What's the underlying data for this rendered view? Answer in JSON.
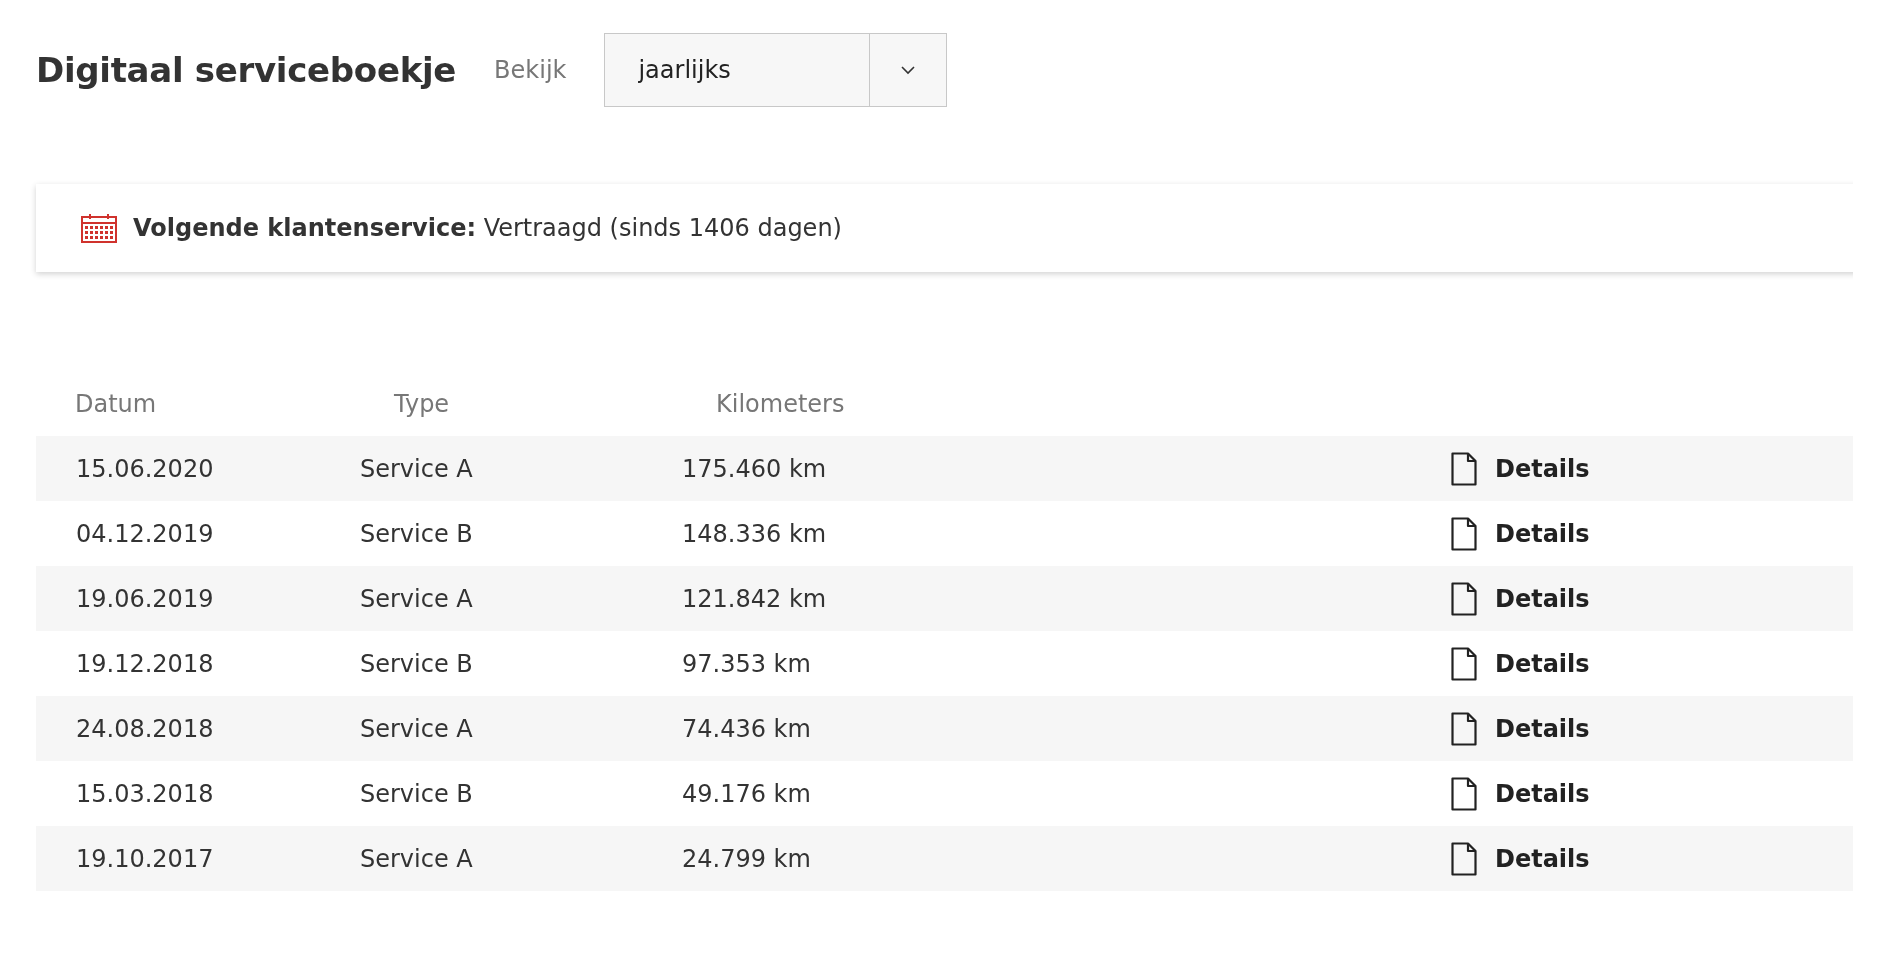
{
  "header": {
    "title": "Digitaal serviceboekje",
    "view_label": "Bekijk",
    "view_select": {
      "value": "jaarlijks"
    }
  },
  "notice": {
    "text": "**Volgende klantenservice:** Vertraagd (sinds 1406 dagen)"
  },
  "table": {
    "columns": [
      "Datum",
      "Type",
      "Kilometers"
    ],
    "rows": [
      {
        "date": "15.06.2020",
        "type": "Service A",
        "km": "175.460 km",
        "action": "Details"
      },
      {
        "date": "04.12.2019",
        "type": "Service B",
        "km": "148.336 km",
        "action": "Details"
      },
      {
        "date": "19.06.2019",
        "type": "Service A",
        "km": "121.842 km",
        "action": "Details"
      },
      {
        "date": "19.12.2018",
        "type": "Service B",
        "km": "97.353 km",
        "action": "Details"
      },
      {
        "date": "24.08.2018",
        "type": "Service A",
        "km": "74.436 km",
        "action": "Details"
      },
      {
        "date": "15.03.2018",
        "type": "Service B",
        "km": "49.176 km",
        "action": "Details"
      },
      {
        "date": "19.10.2017",
        "type": "Service A",
        "km": "24.799 km",
        "action": "Details"
      }
    ]
  }
}
